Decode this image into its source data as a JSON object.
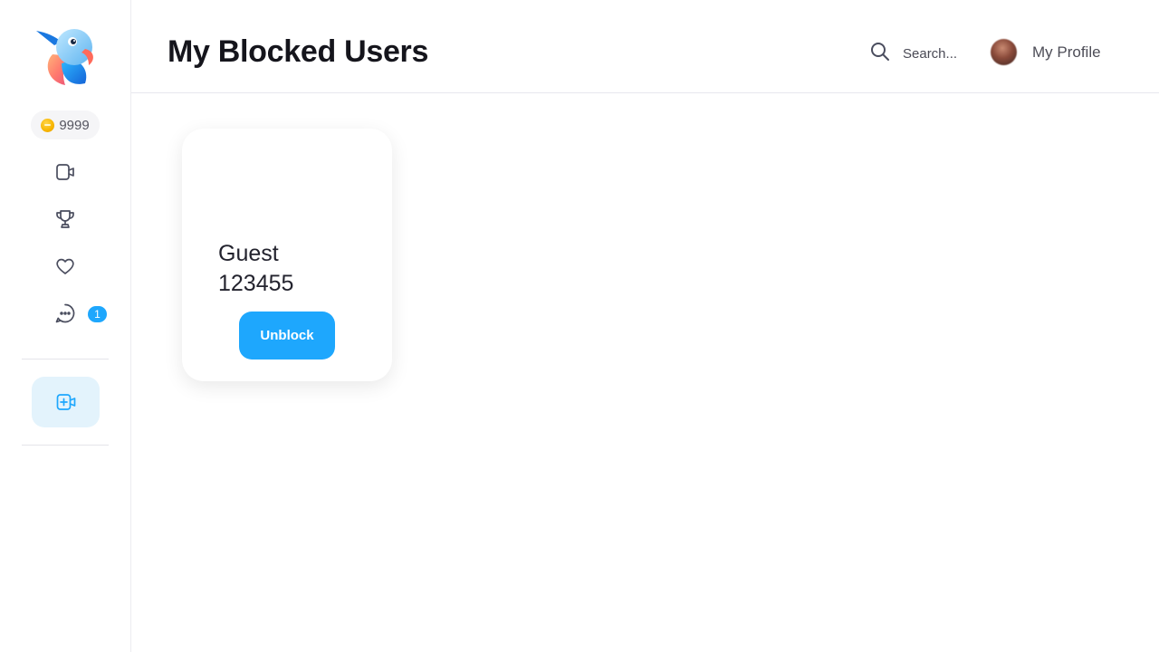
{
  "sidebar": {
    "logo_icon": "parrot-logo-icon",
    "coins": "9999",
    "coin_icon": "coin-icon",
    "items": [
      {
        "name": "video-call",
        "icon": "video-camera-icon"
      },
      {
        "name": "leaderboard",
        "icon": "trophy-icon"
      },
      {
        "name": "favorites",
        "icon": "heart-icon"
      },
      {
        "name": "messages",
        "icon": "chat-bubble-icon",
        "badge": "1"
      }
    ],
    "add_room_icon": "add-video-icon"
  },
  "header": {
    "title": "My Blocked Users",
    "search_placeholder": "Search...",
    "profile_label": "My Profile"
  },
  "blocked_users": [
    {
      "name": "Guest 123455",
      "action_label": "Unblock"
    }
  ],
  "colors": {
    "accent": "#1ea7fd",
    "accent_light": "#e3f3fc",
    "icon_gray": "#4a4d5e",
    "coin": "#f7b500"
  }
}
